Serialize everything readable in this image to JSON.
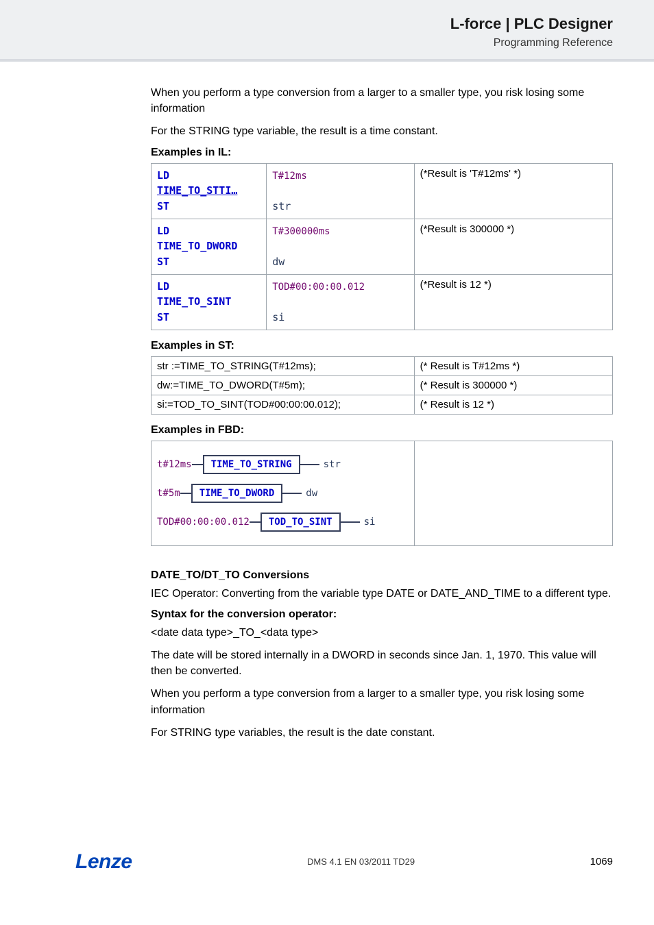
{
  "header": {
    "title": "L-force | PLC Designer",
    "subtitle": "Programming Reference"
  },
  "intro": {
    "p1": "When you perform a type conversion from a larger to a smaller type, you risk losing some information",
    "p2": "For the STRING type variable, the result is a time constant."
  },
  "il": {
    "label": "Examples in IL:",
    "rows": [
      {
        "code": {
          "l1_kw": "LD",
          "l1_arg": "T#12ms",
          "l2_kw": "TIME_TO_STTI…",
          "l3_kw": "ST",
          "l3_arg": "str"
        },
        "result": "(*Result is 'T#12ms' *)"
      },
      {
        "code": {
          "l1_kw": "LD",
          "l1_arg": "T#300000ms",
          "l2_kw": "TIME_TO_DWORD",
          "l3_kw": "ST",
          "l3_arg": "dw"
        },
        "result": "(*Result is 300000 *)"
      },
      {
        "code": {
          "l1_kw": "LD",
          "l1_arg": "TOD#00:00:00.012",
          "l2_kw": "TIME_TO_SINT",
          "l3_kw": "ST",
          "l3_arg": "si"
        },
        "result": "(*Result is 12 *)"
      }
    ]
  },
  "st": {
    "label": "Examples in ST:",
    "rows": [
      {
        "code": "str :=TIME_TO_STRING(T#12ms);",
        "result": "(* Result is T#12ms *)"
      },
      {
        "code": "dw:=TIME_TO_DWORD(T#5m);",
        "result": "(* Result is 300000 *)"
      },
      {
        "code": "si:=TOD_TO_SINT(TOD#00:00:00.012);",
        "result": "(* Result is 12 *)"
      }
    ]
  },
  "fbd": {
    "label": "Examples in FBD:",
    "rows": [
      {
        "in": "t#12ms",
        "box": "TIME_TO_STRING",
        "out": "str"
      },
      {
        "in": "t#5m",
        "box": "TIME_TO_DWORD",
        "out": "dw"
      },
      {
        "in": "TOD#00:00:00.012",
        "box": "TOD_TO_SINT",
        "out": "si"
      }
    ]
  },
  "date_conv": {
    "heading": "DATE_TO/DT_TO Conversions",
    "p1": "IEC Operator: Converting from the variable type DATE or DATE_AND_TIME to a different type.",
    "syntax_label": "Syntax for the conversion operator:",
    "syntax_line": "<date data type>_TO_<data type>",
    "p2": "The date will be stored internally in a DWORD in seconds since Jan. 1, 1970. This value will then be converted.",
    "p3": "When you perform a type conversion from a larger to a smaller type, you risk losing some information",
    "p4": "For STRING type variables, the result is the date constant."
  },
  "footer": {
    "logo": "Lenze",
    "center": "DMS 4.1 EN 03/2011 TD29",
    "page": "1069"
  }
}
